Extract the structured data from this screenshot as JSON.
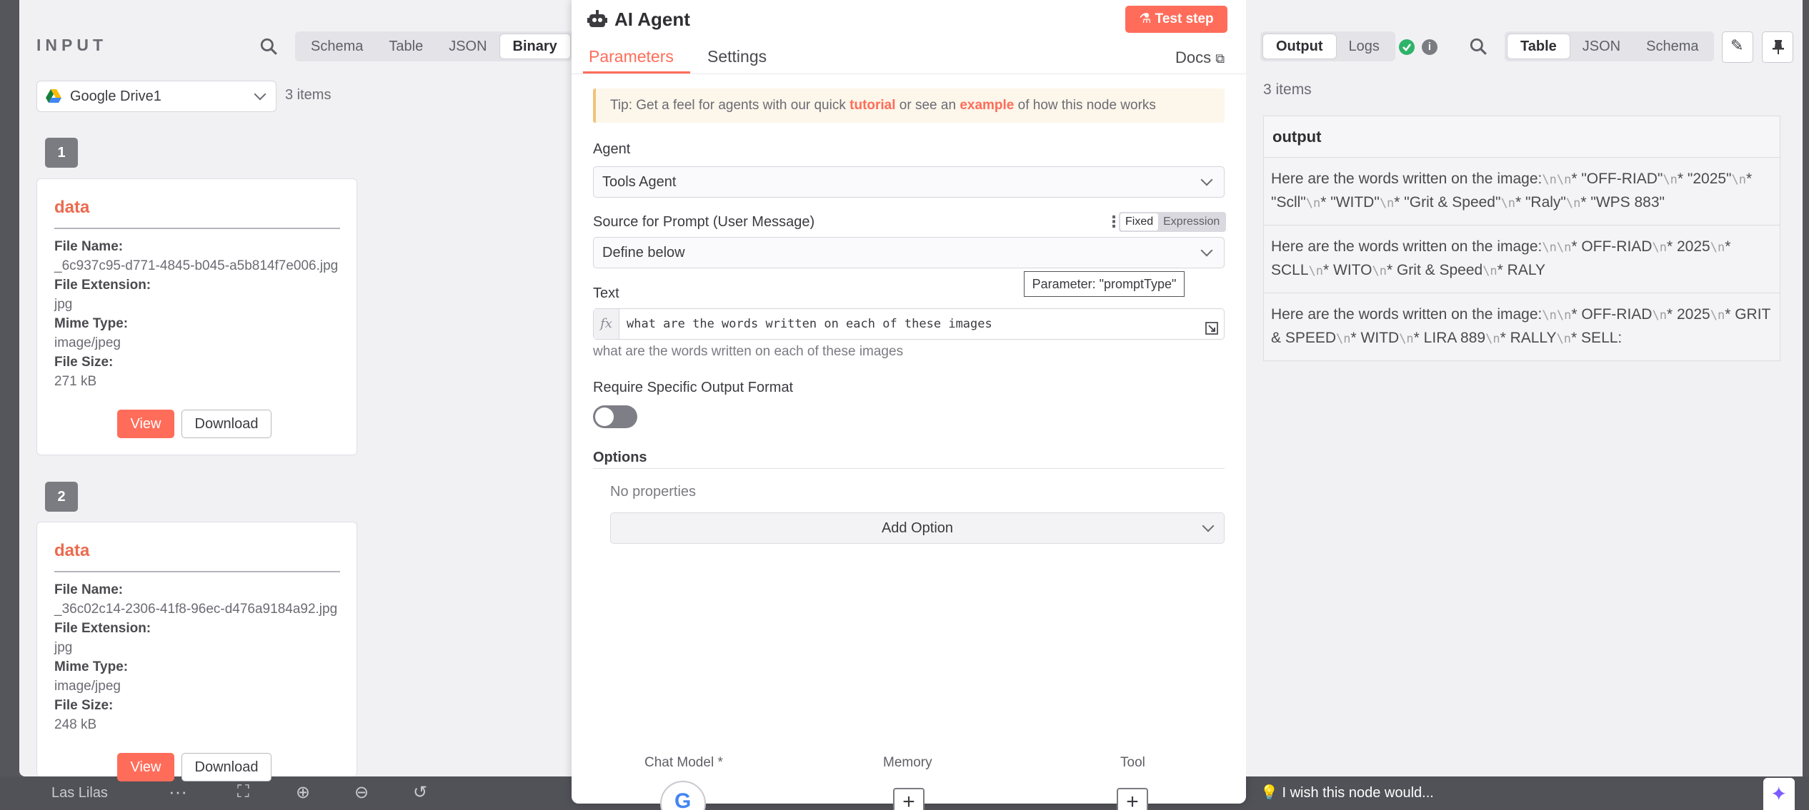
{
  "input": {
    "title": "INPUT",
    "views": [
      "Schema",
      "Table",
      "JSON",
      "Binary"
    ],
    "active_view": "Binary",
    "node_select": "Google Drive1",
    "items_count": "3 items",
    "items": [
      {
        "index": "1",
        "key": "data",
        "file_name_label": "File Name:",
        "file_name": "_6c937c95-d771-4845-b045-a5b814f7e006.jpg",
        "file_ext_label": "File Extension:",
        "file_ext": "jpg",
        "mime_label": "Mime Type:",
        "mime": "image/jpeg",
        "size_label": "File Size:",
        "size": "271 kB",
        "view_label": "View",
        "download_label": "Download"
      },
      {
        "index": "2",
        "key": "data",
        "file_name_label": "File Name:",
        "file_name": "_36c02c14-2306-41f8-96ec-d476a9184a92.jpg",
        "file_ext_label": "File Extension:",
        "file_ext": "jpg",
        "mime_label": "Mime Type:",
        "mime": "image/jpeg",
        "size_label": "File Size:",
        "size": "248 kB",
        "view_label": "View",
        "download_label": "Download"
      }
    ]
  },
  "node": {
    "title": "AI Agent",
    "test_step": "Test step",
    "tabs": [
      "Parameters",
      "Settings"
    ],
    "docs": "Docs",
    "tip": {
      "prefix": "Tip: Get a feel for agents with our quick ",
      "link1": "tutorial",
      "middle": " or see an ",
      "link2": "example",
      "suffix": " of how this node works"
    },
    "agent_label": "Agent",
    "agent_value": "Tools Agent",
    "source_label": "Source for Prompt (User Message)",
    "mode_fixed": "Fixed",
    "mode_expression": "Expression",
    "source_value": "Define below",
    "tooltip": "Parameter: \"promptType\"",
    "text_label": "Text",
    "fx": "fx",
    "text_value": "what are the words written on each of these images",
    "text_hint": "what are the words written on each of these images",
    "require_label": "Require Specific Output Format",
    "options_label": "Options",
    "no_properties": "No properties",
    "add_option": "Add Option",
    "sub_nodes": [
      "Chat Model *",
      "Memory",
      "Tool"
    ]
  },
  "output": {
    "tabs": [
      "Output",
      "Logs"
    ],
    "views": [
      "Table",
      "JSON",
      "Schema"
    ],
    "active_view": "Table",
    "items_count": "3 items",
    "column": "output",
    "rows": [
      [
        "Here are the words written on the image:",
        "\\n\\n",
        "*  \"OFF-RIAD\"",
        "\\n",
        "*  \"2025\"",
        "\\n",
        "*  \"Scll\"",
        "\\n",
        "*  \"WITD\"",
        "\\n",
        "*  \"Grit & Speed\"",
        "\\n",
        "*  \"Raly\"",
        "\\n",
        "*  \"WPS 883\""
      ],
      [
        "Here are the words written on the image:",
        "\\n\\n",
        "*  OFF-RIAD",
        "\\n",
        "*  2025",
        "\\n",
        "*  SCLL",
        "\\n",
        "*  WITO",
        "\\n",
        "*  Grit & Speed",
        "\\n",
        "*  RALY"
      ],
      [
        "Here are the words written on the image:",
        "\\n\\n",
        "*  OFF-RIAD",
        "\\n",
        "*  2025",
        "\\n",
        "*  GRIT & SPEED",
        "\\n",
        "*  WITD",
        "\\n",
        "*  LIRA 889",
        "\\n",
        "*  RALLY",
        "\\n",
        "*  SELL:"
      ]
    ]
  },
  "canvas": {
    "workflow_name": "Las Lilas",
    "feedback": "I wish this node would..."
  },
  "colors": {
    "accent": "#ff6d5a",
    "success": "#2fb36a"
  }
}
